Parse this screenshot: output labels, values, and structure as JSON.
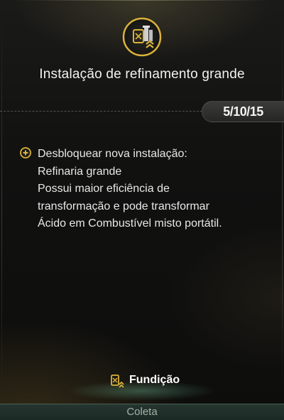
{
  "title": "Instalação de refinamento grande",
  "level": "5/10/15",
  "bonus": {
    "icon": "plus-circle-icon",
    "lines": [
      "Desbloquear nova instalação:",
      "Refinaria grande",
      "Possui maior eficiência de",
      "transformação e pode transformar",
      "Ácido em Combustível misto portátil."
    ]
  },
  "tabs": {
    "active_label": "Fundição",
    "active_icon": "fuel-can-upgrade-icon",
    "next_label": "Coleta"
  },
  "colors": {
    "accent": "#d9b23a",
    "text": "#e8e8e8"
  }
}
